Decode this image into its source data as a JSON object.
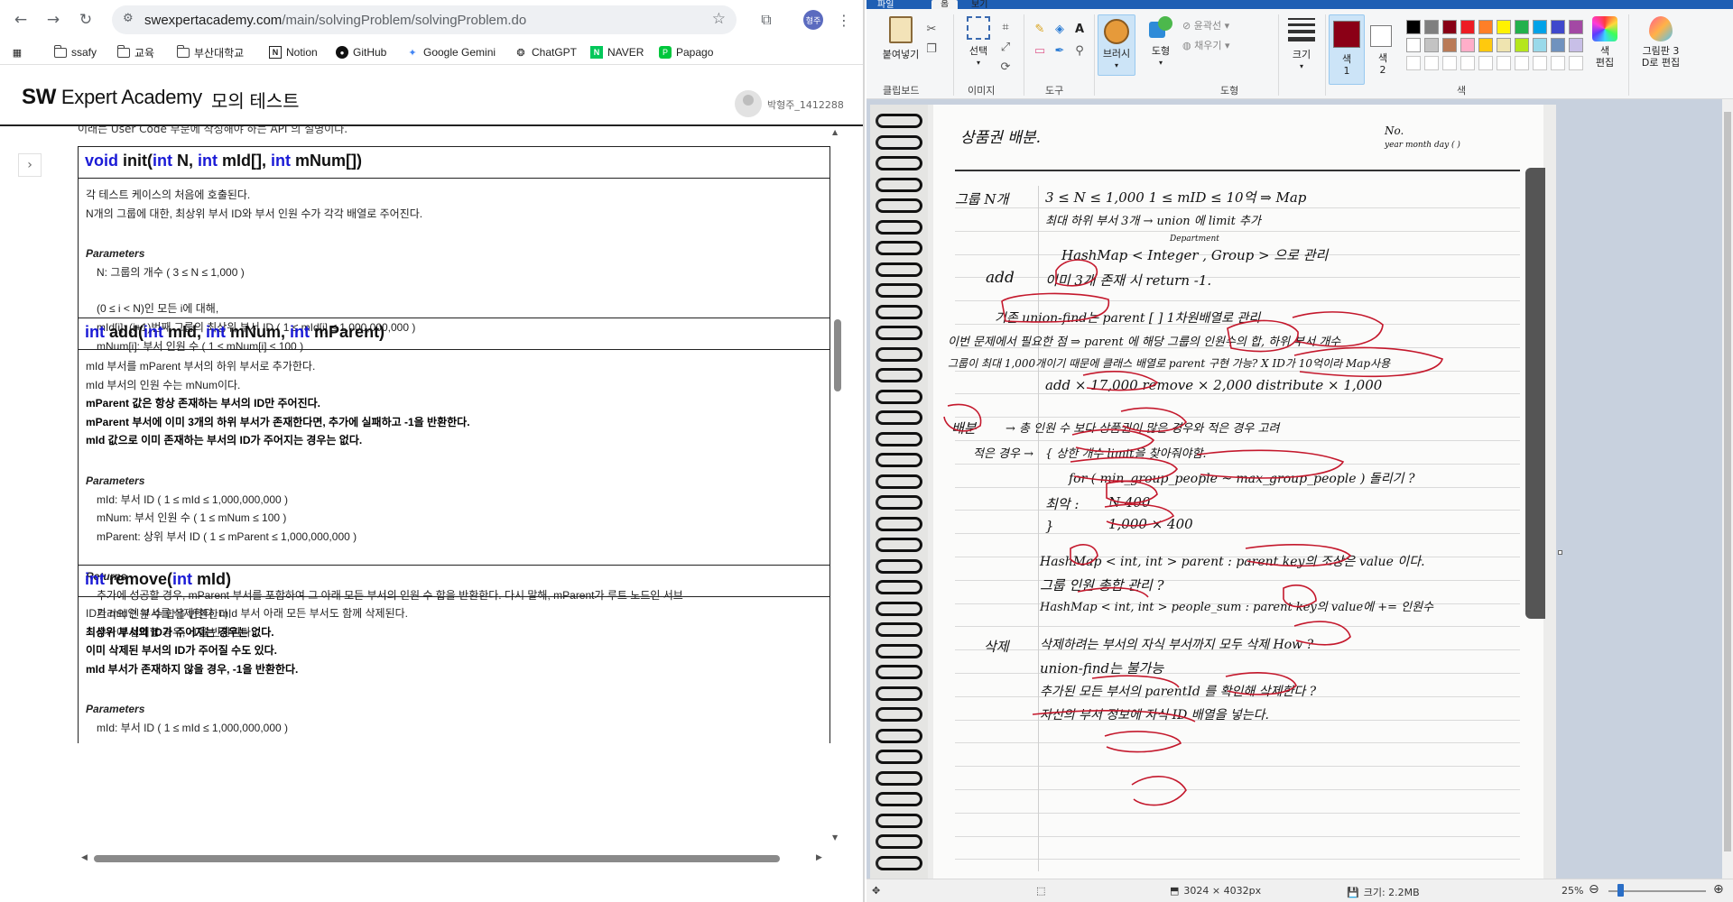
{
  "browser": {
    "url_main": "swexpertacademy.com",
    "url_path": "/main/solvingProblem/solvingProblem.do",
    "profile_initials": "형주",
    "bookmarks": [
      {
        "label": "ssafy",
        "icon": "folder-icon"
      },
      {
        "label": "교육",
        "icon": "folder-icon"
      },
      {
        "label": "부산대학교",
        "icon": "folder-icon"
      },
      {
        "label": "Notion",
        "icon": "notion-icon"
      },
      {
        "label": "GitHub",
        "icon": "github-icon"
      },
      {
        "label": "Google Gemini",
        "icon": "gemini-icon"
      },
      {
        "label": "ChatGPT",
        "icon": "chatgpt-icon"
      },
      {
        "label": "NAVER",
        "icon": "naver-icon"
      },
      {
        "label": "Papago",
        "icon": "papago-icon"
      }
    ]
  },
  "site": {
    "logo_bold": "SW",
    "logo_rest": " Expert Academy",
    "page_title": "모의 테스트",
    "user_name": "박형주_1412288",
    "cut_line": "이래는 User Code 부분에 작성해야 하는 API 의 설명이다."
  },
  "apis": [
    {
      "ret": "void",
      "name": " init(",
      "params": [
        [
          "int",
          " N, "
        ],
        [
          "int",
          " mId[], "
        ],
        [
          "int",
          " mNum[])"
        ]
      ],
      "lines": [
        {
          "t": "각 테스트 케이스의 처음에 호출된다.",
          "c": ""
        },
        {
          "t": "N개의 그룹에 대한, 최상위 부서 ID와 부서 인원 수가 각각 배열로 주어진다.",
          "c": ""
        },
        {
          "t": "",
          "c": "gap"
        },
        {
          "t": "Parameters",
          "c": "sec"
        },
        {
          "t": "N: 그룹의 개수 ( 3 ≤ N ≤ 1,000 )",
          "c": "ind"
        },
        {
          "t": "",
          "c": "gap"
        },
        {
          "t": "(0 ≤ i  < N)인 모든 i에 대해,",
          "c": "ind"
        },
        {
          "t": "mId[i]: (i+1)번째 그룹의 최상위 부서 ID ( 1 ≤ mId[i] ≤ 1,000,000,000 )",
          "c": "ind"
        },
        {
          "t": "mNum[i]: 부서 인원 수 ( 1 ≤ mNum[i] ≤ 100 )",
          "c": "ind"
        }
      ]
    },
    {
      "ret": "int",
      "name": " add(",
      "params": [
        [
          "int",
          " mId, "
        ],
        [
          "int",
          " mNum, "
        ],
        [
          "int",
          " mParent)"
        ]
      ],
      "lines": [
        {
          "t": "mId 부서를 mParent 부서의 하위 부서로 추가한다.",
          "c": ""
        },
        {
          "t": "mId 부서의 인원 수는 mNum이다.",
          "c": ""
        },
        {
          "t": "mParent 값은 항상 존재하는 부서의 ID만 주어진다.",
          "c": "b"
        },
        {
          "t": "mParent 부서에 이미 3개의 하위 부서가 존재한다면, 추가에 실패하고 -1을 반환한다.",
          "c": "b"
        },
        {
          "t": "mId 값으로 이미 존재하는 부서의 ID가 주어지는 경우는 없다.",
          "c": "b"
        },
        {
          "t": "",
          "c": "gap"
        },
        {
          "t": "Parameters",
          "c": "sec"
        },
        {
          "t": "mId: 부서 ID ( 1 ≤ mId ≤ 1,000,000,000 )",
          "c": "ind"
        },
        {
          "t": "mNum: 부서 인원 수 ( 1 ≤ mNum ≤ 100 )",
          "c": "ind"
        },
        {
          "t": "mParent: 상위 부서 ID ( 1 ≤ mParent ≤ 1,000,000,000 )",
          "c": "ind"
        },
        {
          "t": "",
          "c": "gap"
        },
        {
          "t": "Returns",
          "c": "sec"
        },
        {
          "t": "추가에 성공할 경우, mParent 부서를 포함하여 그 아래 모든 부서의 인원 수 합을 반환한다. 다시 말해, mParent가 루트 노드인 서브",
          "c": "ind"
        },
        {
          "t": "트리의 인원 수 합을 반환한다.",
          "c": "ind"
        },
        {
          "t": "추가에 실패할 경우, -1을 반환한다.",
          "c": "ind"
        }
      ]
    },
    {
      "ret": "int",
      "name": " remove(",
      "params": [
        [
          "int",
          " mId)"
        ]
      ],
      "lines": [
        {
          "t": "ID가 mId인 부서를 삭제한다. mId 부서 아래 모든 부서도 함께 삭제된다.",
          "c": ""
        },
        {
          "t": "최상위 부서의 ID가 주어지는 경우는 없다.",
          "c": "b"
        },
        {
          "t": "이미 삭제된 부서의 ID가 주어질 수도 있다.",
          "c": "b"
        },
        {
          "t": "mId 부서가 존재하지 않을 경우, -1을 반환한다.",
          "c": "b"
        },
        {
          "t": "",
          "c": "gap"
        },
        {
          "t": "Parameters",
          "c": "sec"
        },
        {
          "t": "mId: 부서 ID ( 1 ≤ mId ≤ 1,000,000,000 )",
          "c": "ind"
        }
      ]
    }
  ],
  "paint": {
    "tabs": {
      "file": "파일",
      "home": "홈",
      "view": "보기"
    },
    "groups": {
      "clipboard": "클립보드",
      "image": "이미지",
      "tools": "도구",
      "shapes": "도형",
      "colors": "색"
    },
    "buttons": {
      "paste": "붙여넣기",
      "select": "선택",
      "brush": "브러시",
      "shapes": "도형",
      "outline": "윤곽선",
      "fill": "채우기",
      "size": "크기",
      "color1": "색\n1",
      "color2": "색\n2",
      "edit_colors": "색\n편집",
      "paint3d": "그림판 3\nD로 편집"
    },
    "color1": "#8b0016",
    "color2": "#ffffff",
    "palette_row1": [
      "#000000",
      "#7f7f7f",
      "#880015",
      "#ed1c24",
      "#ff7f27",
      "#fff200",
      "#22b14c",
      "#00a2e8",
      "#3f48cc",
      "#a349a4"
    ],
    "palette_row2": [
      "#ffffff",
      "#c3c3c3",
      "#b97a57",
      "#ffaec9",
      "#ffc90e",
      "#efe4b0",
      "#b5e61d",
      "#99d9ea",
      "#7092be",
      "#c8bfe7"
    ],
    "status": {
      "dimensions": "3024 × 4032px",
      "size": "크기: 2.2MB",
      "zoom": "25%"
    },
    "zoom_level": 0.12,
    "notes": {
      "header_title": "상품권 배분.",
      "header_no": "No.",
      "header_date": "year       month       day  (        )",
      "l1a": "그룹 N개",
      "l1b": "3 ≤ N ≤ 1,000      1 ≤ mID ≤ 10억  ⇒ Map",
      "l2": "최대 하위 부서 3개  →  union 에 limit 추가",
      "l3_top": "Department",
      "l3": "HashMap < Integer , Group >  으로 관리",
      "l4a": "add",
      "l4b": "이미 3개 존재 시   return -1.",
      "l5": "기존  union-find는  parent [ ]  1차원배열로 관리",
      "l6": "이번 문제에서 필요한 점  ⇒  parent 에 해당 그룹의 인원수의 합, 하위 부서 개수",
      "l7": "그룹이 최대 1,000개이기 때문에  클래스 배열로  parent 구현 가능? X  ID가 10억이라 Map사용",
      "l8": "add × 17,000     remove × 2,000     distribute × 1,000",
      "l9a": "배분",
      "l9b": "→  총 인원 수 보다  상품권이 많은 경우와 적은 경우 고려",
      "l10a": "적은 경우 →",
      "l10b": "{  상한 개수 limit을 찾아줘야함.",
      "l11": "for ( min_group_people  ~  max_group_people )  돌리기 ?",
      "l12a": "최악 :",
      "l12b": "N 400",
      "l13a": "}",
      "l13b": "1,000 × 400",
      "l14": "HashMap < int, int >  parent :  parent key의 조상은 value 이다.",
      "l15": "그룹 인원 총합 관리 ?",
      "l16": "HashMap < int, int >  people_sum :  parent key의  value에   += 인원수",
      "l17a": "삭제",
      "l17b": "삭제하려는 부서의  자식 부서까지 모두 삭제  How ?",
      "l18": "union-find는 불가능",
      "l19": "추가된 모든 부서의  parentId 를 확인해 삭제한다 ?",
      "l20": "자신의 부서 정보에  자식 ID 배열을 넣는다."
    }
  }
}
